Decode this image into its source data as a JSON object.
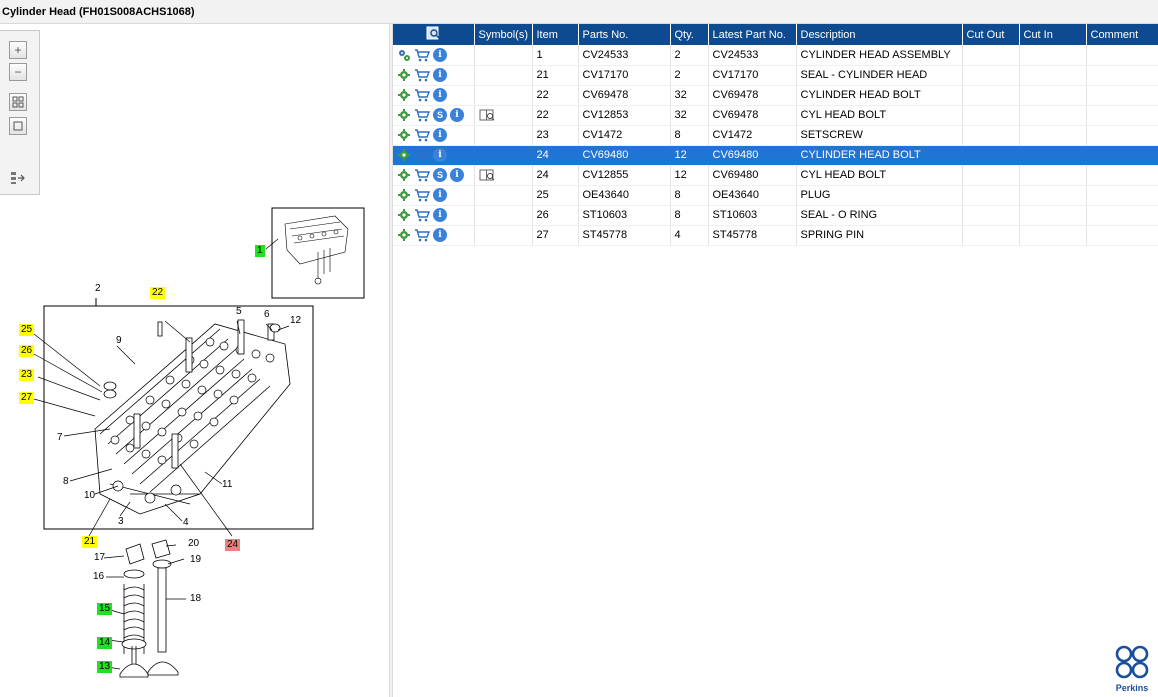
{
  "window": {
    "title": "Cylinder Head (FH01S008ACHS1068)"
  },
  "toolbox": {
    "zoom_in": "+",
    "zoom_out": "−"
  },
  "diagram": {
    "callouts": [
      {
        "label": "2",
        "style": "plain"
      },
      {
        "label": "22",
        "style": "yellow"
      },
      {
        "label": "25",
        "style": "yellow"
      },
      {
        "label": "26",
        "style": "yellow"
      },
      {
        "label": "23",
        "style": "yellow"
      },
      {
        "label": "27",
        "style": "yellow"
      },
      {
        "label": "5",
        "style": "plain"
      },
      {
        "label": "6",
        "style": "plain"
      },
      {
        "label": "12",
        "style": "plain"
      },
      {
        "label": "9",
        "style": "plain"
      },
      {
        "label": "7",
        "style": "plain"
      },
      {
        "label": "8",
        "style": "plain"
      },
      {
        "label": "10",
        "style": "plain"
      },
      {
        "label": "11",
        "style": "plain"
      },
      {
        "label": "3",
        "style": "plain"
      },
      {
        "label": "4",
        "style": "plain"
      },
      {
        "label": "21",
        "style": "yellow"
      },
      {
        "label": "24",
        "style": "red"
      },
      {
        "label": "20",
        "style": "plain"
      },
      {
        "label": "17",
        "style": "plain"
      },
      {
        "label": "19",
        "style": "plain"
      },
      {
        "label": "16",
        "style": "plain"
      },
      {
        "label": "18",
        "style": "plain"
      },
      {
        "label": "15",
        "style": "green"
      },
      {
        "label": "14",
        "style": "green"
      },
      {
        "label": "13",
        "style": "green"
      },
      {
        "label": "1",
        "style": "green"
      }
    ]
  },
  "grid": {
    "columns": [
      "",
      "Symbol(s)",
      "Item",
      "Parts No.",
      "Qty.",
      "Latest Part No.",
      "Description",
      "Cut Out",
      "Cut In",
      "Comment"
    ],
    "rows": [
      {
        "icons": [
          "gears-icon",
          "cart-icon",
          "info-icon"
        ],
        "symbol": "",
        "item": "1",
        "part": "CV24533",
        "qty": "2",
        "latest": "CV24533",
        "desc": "CYLINDER HEAD ASSEMBLY",
        "cut_out": "",
        "cut_in": "",
        "comment": "",
        "selected": false
      },
      {
        "icons": [
          "gear-icon",
          "cart-icon",
          "info-icon"
        ],
        "symbol": "",
        "item": "21",
        "part": "CV17170",
        "qty": "2",
        "latest": "CV17170",
        "desc": "SEAL - CYLINDER HEAD",
        "cut_out": "",
        "cut_in": "",
        "comment": "",
        "selected": false
      },
      {
        "icons": [
          "gear-icon",
          "cart-icon",
          "info-icon"
        ],
        "symbol": "",
        "item": "22",
        "part": "CV69478",
        "qty": "32",
        "latest": "CV69478",
        "desc": "CYLINDER HEAD BOLT",
        "cut_out": "",
        "cut_in": "",
        "comment": "",
        "selected": false
      },
      {
        "icons": [
          "gear-icon",
          "cart-icon",
          "service-icon",
          "info-icon"
        ],
        "symbol": "book-icon",
        "item": "22",
        "part": "CV12853",
        "qty": "32",
        "latest": "CV69478",
        "desc": "CYL HEAD BOLT",
        "cut_out": "",
        "cut_in": "",
        "comment": "",
        "selected": false
      },
      {
        "icons": [
          "gear-icon",
          "cart-icon",
          "info-icon"
        ],
        "symbol": "",
        "item": "23",
        "part": "CV1472",
        "qty": "8",
        "latest": "CV1472",
        "desc": "SETSCREW",
        "cut_out": "",
        "cut_in": "",
        "comment": "",
        "selected": false
      },
      {
        "icons": [
          "gear-icon",
          "cart-icon",
          "info-icon"
        ],
        "symbol": "",
        "item": "24",
        "part": "CV69480",
        "qty": "12",
        "latest": "CV69480",
        "desc": "CYLINDER HEAD BOLT",
        "cut_out": "",
        "cut_in": "",
        "comment": "",
        "selected": true
      },
      {
        "icons": [
          "gear-icon",
          "cart-icon",
          "service-icon",
          "info-icon"
        ],
        "symbol": "book-icon",
        "item": "24",
        "part": "CV12855",
        "qty": "12",
        "latest": "CV69480",
        "desc": "CYL HEAD BOLT",
        "cut_out": "",
        "cut_in": "",
        "comment": "",
        "selected": false
      },
      {
        "icons": [
          "gear-icon",
          "cart-icon",
          "info-icon"
        ],
        "symbol": "",
        "item": "25",
        "part": "OE43640",
        "qty": "8",
        "latest": "OE43640",
        "desc": "PLUG",
        "cut_out": "",
        "cut_in": "",
        "comment": "",
        "selected": false
      },
      {
        "icons": [
          "gear-icon",
          "cart-icon",
          "info-icon"
        ],
        "symbol": "",
        "item": "26",
        "part": "ST10603",
        "qty": "8",
        "latest": "ST10603",
        "desc": "SEAL - O RING",
        "cut_out": "",
        "cut_in": "",
        "comment": "",
        "selected": false
      },
      {
        "icons": [
          "gear-icon",
          "cart-icon",
          "info-icon"
        ],
        "symbol": "",
        "item": "27",
        "part": "ST45778",
        "qty": "4",
        "latest": "ST45778",
        "desc": "SPRING PIN",
        "cut_out": "",
        "cut_in": "",
        "comment": "",
        "selected": false
      }
    ]
  },
  "brand": {
    "name": "Perkins"
  },
  "colors": {
    "header": "#0e4a8f",
    "selection": "#1e75d3",
    "callout_yellow": "#ffff00",
    "callout_green": "#22e022",
    "callout_red": "#f08080"
  }
}
